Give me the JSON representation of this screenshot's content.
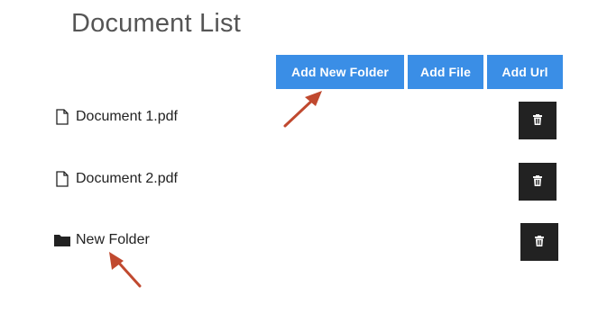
{
  "page": {
    "title": "Document List"
  },
  "toolbar": {
    "add_folder_label": "Add New Folder",
    "add_file_label": "Add File",
    "add_url_label": "Add Url",
    "button_color": "#3a8ee6"
  },
  "documents": [
    {
      "name": "Document 1.pdf",
      "icon": "file-icon"
    },
    {
      "name": "Document 2.pdf",
      "icon": "file-icon"
    },
    {
      "name": "New Folder",
      "icon": "folder-icon"
    }
  ],
  "colors": {
    "delete_button": "#222222",
    "annotation_arrow": "#c0492f"
  }
}
